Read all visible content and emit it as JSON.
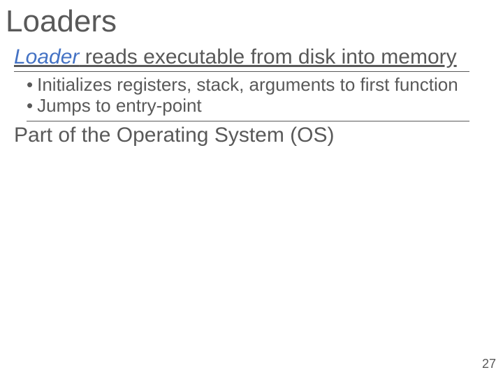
{
  "title": "Loaders",
  "line1_italic": "Loader",
  "line1_rest": " reads executable from disk into memory",
  "bullets": {
    "b1": "Initializes registers, stack, arguments to first function",
    "b2": "Jumps to entry-point"
  },
  "line2": "Part of the Operating System (OS)",
  "page_number": "27"
}
